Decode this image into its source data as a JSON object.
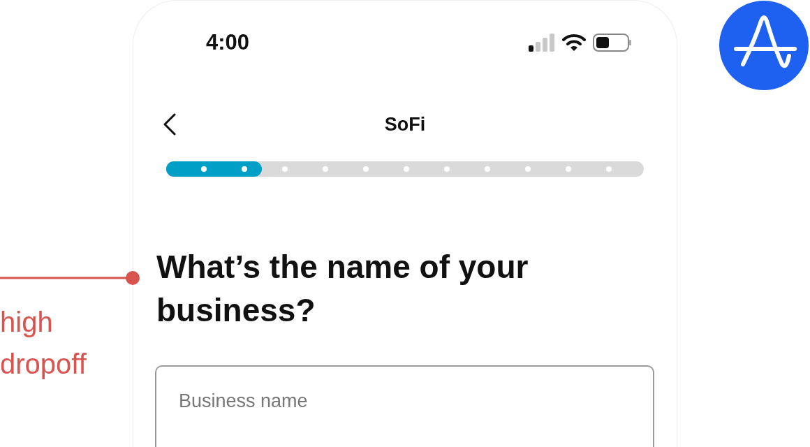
{
  "annotation": {
    "label": "high dropoff"
  },
  "status_bar": {
    "time": "4:00"
  },
  "nav": {
    "title": "SoFi"
  },
  "progress": {
    "level": 0.2
  },
  "question": {
    "heading": "What’s the name of your business?"
  },
  "business_name_field": {
    "placeholder": "Business name"
  }
}
